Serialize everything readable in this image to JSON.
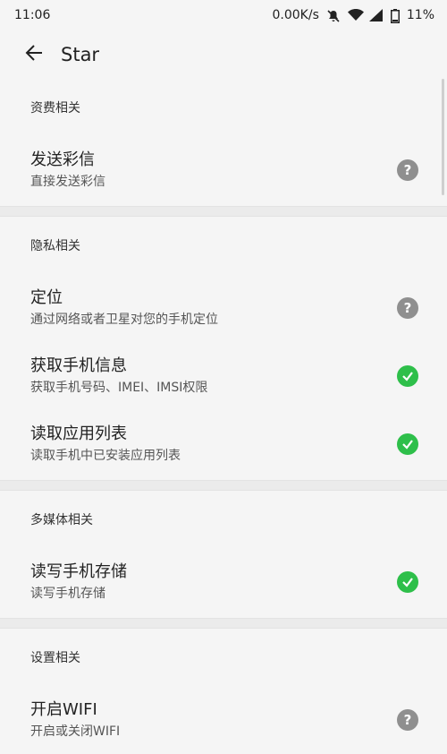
{
  "status_bar": {
    "time": "11:06",
    "speed": "0.00K/s",
    "battery": "11%",
    "icons": [
      "mute-bell-icon",
      "wifi-icon",
      "signal-icon",
      "battery-icon"
    ]
  },
  "app_bar": {
    "title": "Star",
    "back_icon": "arrow-left-icon"
  },
  "sections": [
    {
      "header": "资费相关",
      "items": [
        {
          "title": "发送彩信",
          "subtitle": "直接发送彩信",
          "status": "help"
        }
      ]
    },
    {
      "header": "隐私相关",
      "items": [
        {
          "title": "定位",
          "subtitle": "通过网络或者卫星对您的手机定位",
          "status": "help"
        },
        {
          "title": "获取手机信息",
          "subtitle": "获取手机号码、IMEI、IMSI权限",
          "status": "granted"
        },
        {
          "title": "读取应用列表",
          "subtitle": "读取手机中已安装应用列表",
          "status": "granted"
        }
      ]
    },
    {
      "header": "多媒体相关",
      "items": [
        {
          "title": "读写手机存储",
          "subtitle": "读写手机存储",
          "status": "granted"
        }
      ]
    },
    {
      "header": "设置相关",
      "items": [
        {
          "title": "开启WIFI",
          "subtitle": "开启或关闭WIFI",
          "status": "help"
        }
      ]
    }
  ],
  "colors": {
    "granted": "#2ebf4a",
    "help": "#8f8f8f",
    "background": "#f5f5f5"
  }
}
